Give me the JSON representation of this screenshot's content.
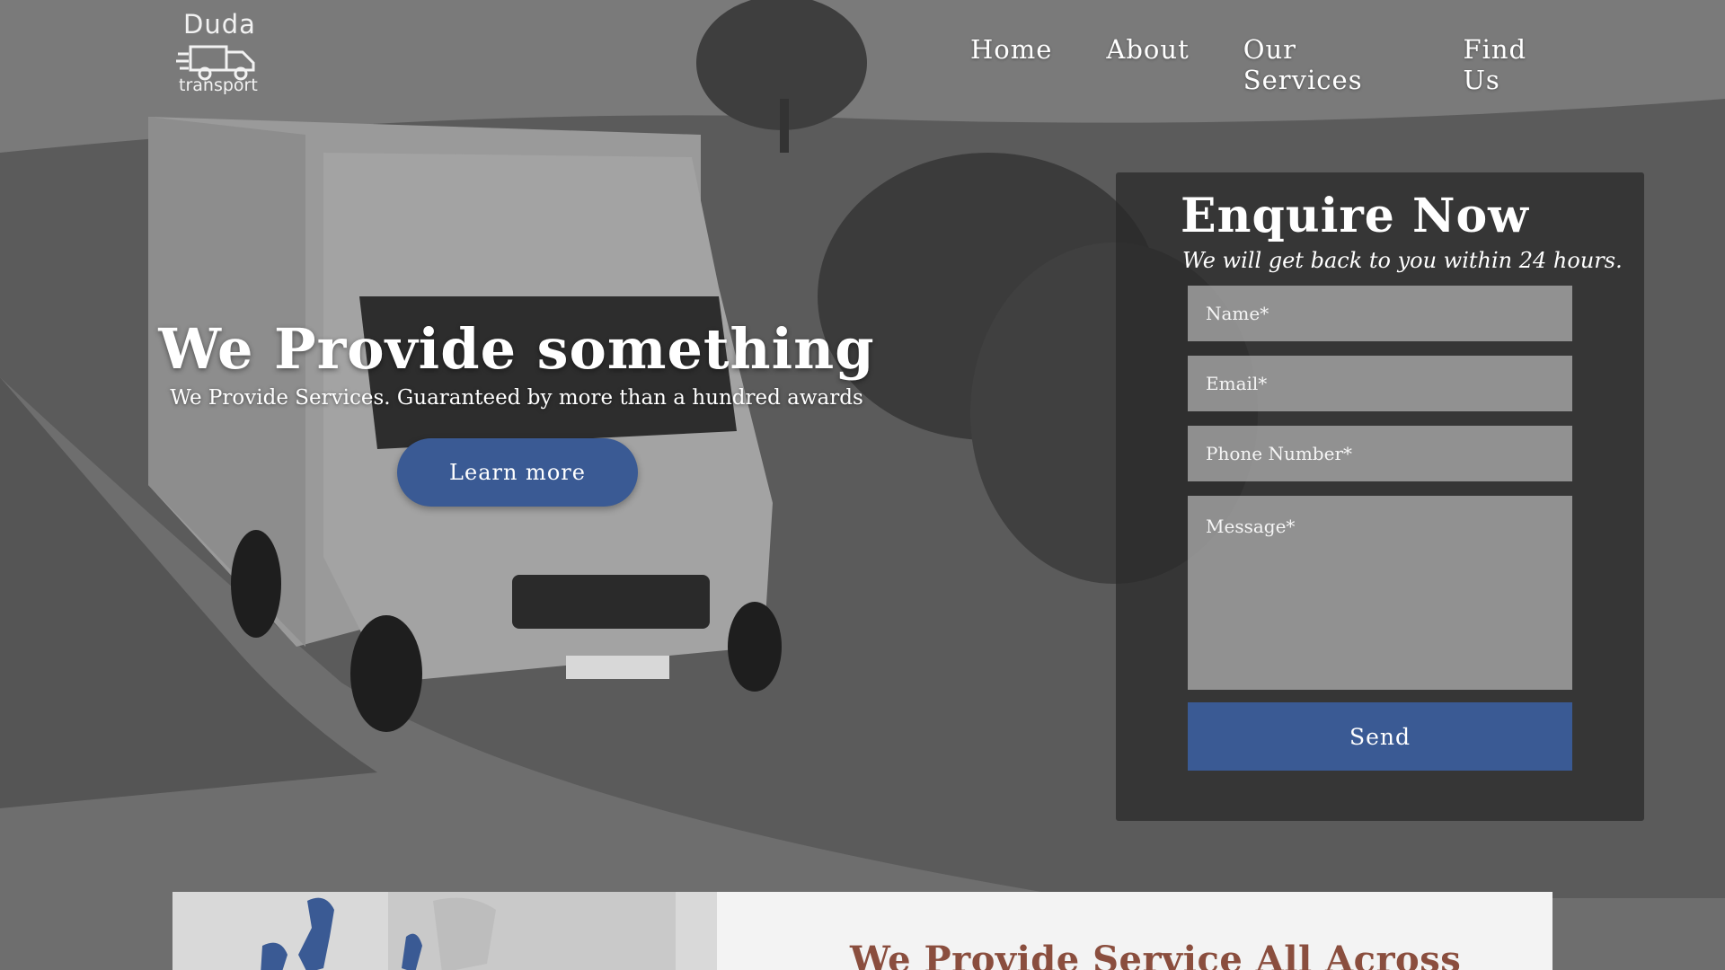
{
  "logo": {
    "top_text": "Duda",
    "bottom_text": "transport",
    "icon": "truck-icon"
  },
  "nav": {
    "items": [
      {
        "label": "Home"
      },
      {
        "label": "About"
      },
      {
        "label": "Our Services"
      },
      {
        "label": "Find Us"
      }
    ]
  },
  "hero": {
    "title": "We Provide something",
    "subtitle": "We Provide Services. Guaranteed by more than a hundred awards",
    "cta_label": "Learn more"
  },
  "enquiry": {
    "title": "Enquire Now",
    "subtitle": "We will get back to you within 24 hours.",
    "fields": {
      "name_placeholder": "Name*",
      "email_placeholder": "Email*",
      "phone_placeholder": "Phone Number*",
      "message_placeholder": "Message*"
    },
    "send_label": "Send"
  },
  "service_section": {
    "heading": "We Provide Service All Across"
  },
  "colors": {
    "accent_blue": "#3a5a94",
    "heading_brown": "#8a4e3e",
    "panel_bg": "rgba(40,40,40,0.72)"
  }
}
